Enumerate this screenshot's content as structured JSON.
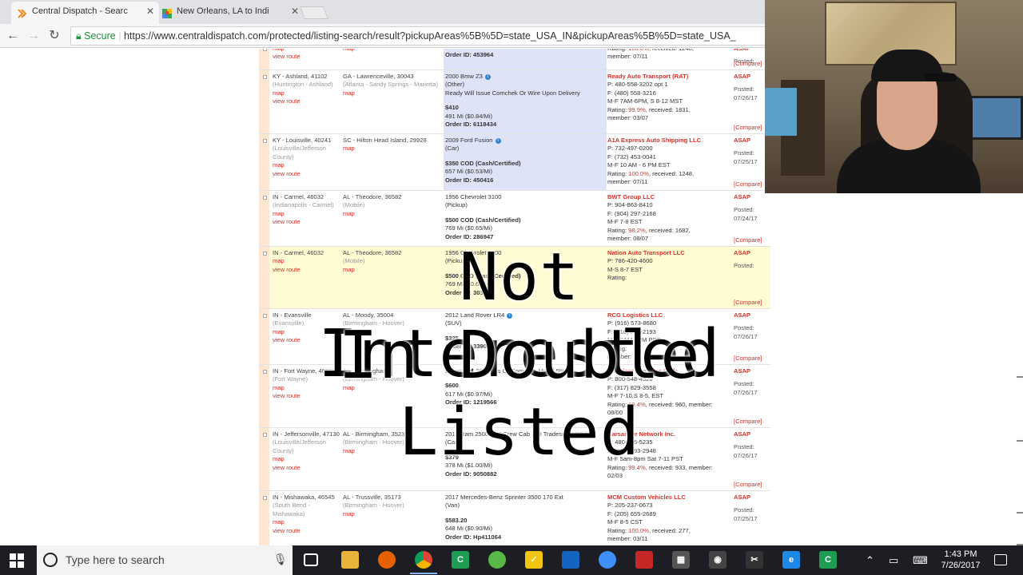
{
  "browser": {
    "tabs": [
      {
        "title": "Central Dispatch - Searc",
        "active": true
      },
      {
        "title": "New Orleans, LA to Indi",
        "active": false
      }
    ],
    "secure_label": "Secure",
    "url": "https://www.centraldispatch.com/protected/listing-search/result?pickupAreas%5B%5D=state_USA_IN&pickupAreas%5B%5D=state_USA_"
  },
  "overlay": {
    "line1": "Not Interested",
    "line2": "In Double Listed"
  },
  "links": {
    "map": "map",
    "view_route": "view route",
    "compare": "[Compare]",
    "asap": "ASAP",
    "posted": "Posted:"
  },
  "listings": [
    {
      "origin": "",
      "origin_sub": "",
      "dest": "",
      "dest_sub": "",
      "vehicle": "",
      "vehicle_type": "",
      "note": "",
      "pay": "999 Mi ($0.43/Mi)",
      "price": "",
      "rate": "",
      "order": "Order ID: 453964",
      "carrier": "",
      "phone": "",
      "phone2": "",
      "hours": "",
      "rating_pre": "Rating: ",
      "rating_pct": "100.0%",
      "rating_post": ", received: 1248,",
      "member": "member: 07/11",
      "posted_date": ""
    },
    {
      "origin": "KY - Ashland, 41102",
      "origin_sub": "(Huntington - Ashland)",
      "dest": "GA - Lawrenceville, 30043",
      "dest_sub": "(Atlanta - Sandy Springs - Marietta)",
      "vehicle": "2000 Bmw Z3",
      "vehicle_type": "(Other)",
      "note": "Ready Will Issue Comchek Or Wire Upon Delivery",
      "price": "$410",
      "rate": "491 Mi ($0.84/Mi)",
      "order": "Order ID: 6118434",
      "carrier": "Ready Auto Transport (RAT)",
      "phone": "P: 480-558-3202 opt 1",
      "phone2": "F: (480) 558-3216",
      "hours": "M-F 7AM-6PM, S 8-12 MST",
      "rating_pre": "Rating: ",
      "rating_pct": "99.9%",
      "rating_post": ", received: 1831,",
      "member": "member: 03/07",
      "posted_date": "07/26/17"
    },
    {
      "origin": "KY - Louisville, 40241",
      "origin_sub": "(Louisville/Jefferson County)",
      "dest": "SC - Hilton Head Island, 29928",
      "dest_sub": "",
      "vehicle": "2009 Ford Fusion",
      "vehicle_type": "(Car)",
      "note": "",
      "price": "$350 COD (Cash/Certified)",
      "rate": "657 Mi ($0.53/Mi)",
      "order": "Order ID: 450416",
      "carrier": "A1A Express Auto Shipping LLC",
      "phone": "P: 732-497-0200",
      "phone2": "F: (732) 453-0041",
      "hours": "M-F 10 AM - 6 PM EST",
      "rating_pre": "Rating: ",
      "rating_pct": "100.0%",
      "rating_post": ", received: 1248,",
      "member": "member: 07/11",
      "posted_date": "07/25/17"
    },
    {
      "origin": "IN - Carmel, 46032",
      "origin_sub": "(Indianapolis - Carmel)",
      "dest": "AL - Theodore, 36582",
      "dest_sub": "(Mobile)",
      "vehicle": "1956 Chevrolet 3100",
      "vehicle_type": "(Pickup)",
      "note": "",
      "price": "$500 COD (Cash/Certified)",
      "rate": "769 Mi ($0.65/Mi)",
      "order": "Order ID: 286947",
      "carrier": "BWT Group LLC",
      "phone": "P: 904-863-8410",
      "phone2": "F: (904) 297-2168",
      "hours": "M-F 7-8 EST",
      "rating_pre": "Rating: ",
      "rating_pct": "98.2%",
      "rating_post": ", received: 1682,",
      "member": "member: 08/07",
      "posted_date": "07/24/17"
    },
    {
      "origin": "IN - Carmel, 46032",
      "origin_sub": "",
      "dest": "AL - Theodore, 36582",
      "dest_sub": "(Mobile)",
      "vehicle": "1956 Chevrolet 3100",
      "vehicle_type": "(Pickup)",
      "note": "",
      "price": "$500 COD (Cash/Certified)",
      "rate": "769 Mi ($0.65/Mi)",
      "order": "Order ID: 303838",
      "carrier": "Nation Auto Transport LLC",
      "phone": "P: 786-420-4600",
      "phone2": "",
      "hours": "M-S 8-7 EST",
      "rating_pre": "Rating: ",
      "rating_pct": "",
      "rating_post": "",
      "member": "",
      "posted_date": ""
    },
    {
      "origin": "IN - Evansville",
      "origin_sub": "(Evansville)",
      "dest": "AL - Moody, 35004",
      "dest_sub": "(Birmingham - Hoover)",
      "vehicle": "2012 Land Rover LR4",
      "vehicle_type": "(SUV)",
      "note": "",
      "price": "$325",
      "rate": "",
      "order": "Order ID: 3390",
      "carrier": "RCG Logistics LLC",
      "phone": "P: (916) 573-8680",
      "phone2": "F: (916) 852-2193",
      "hours": "M-F 8AM-4PM PST",
      "rating_pre": "Rating: ",
      "rating_pct": "",
      "rating_post": "",
      "member": "member: 1",
      "posted_date": "07/26/17"
    },
    {
      "origin": "IN - Fort Wayne, 46808",
      "origin_sub": "(Fort Wayne)",
      "dest": "AL - Birmingham",
      "dest_sub": "(Birmingham - Hoover)",
      "vehicle": "",
      "vehicle_type": "",
      "note": "Billing: Net 20 Terms Or Comchek Minus 5%Fee",
      "price": "$600",
      "rate": "617 Mi ($0.97/Mi)",
      "order": "Order ID: 1219566",
      "carrier": "Reindeer Logistics Corp",
      "phone": "P: 800-548-4520",
      "phone2": "F: (317) 829-3558",
      "hours": "M-F 7-10,S 8-5, EST",
      "rating_pre": "Rating: ",
      "rating_pct": "99.4%",
      "rating_post": ", received: 960, member:",
      "member": "08/00",
      "posted_date": "07/26/17"
    },
    {
      "origin": "IN - Jeffersonville, 47130",
      "origin_sub": "(Louisville/Jefferson County)",
      "dest": "AL - Birmingham, 35233",
      "dest_sub": "(Birmingham - Hoover)",
      "vehicle": "2013 Ram 2500 4wd Crew Cab 169 Tradesman White",
      "vehicle_type": "(Car)",
      "note": "",
      "price": "$379",
      "rate": "378 Mi ($1.00/Mi)",
      "order": "Order ID: 9050882",
      "carrier": "Carsarrive Network Inc.",
      "phone": "P: 480-556-5235",
      "phone2": "F: (480) 393-2948",
      "hours": "M-F 5am-8pm Sat 7-11 PST",
      "rating_pre": "Rating: ",
      "rating_pct": "99.4%",
      "rating_post": ", received: 933, member:",
      "member": "02/03",
      "posted_date": "07/26/17"
    },
    {
      "origin": "IN - Mishawaka, 46545",
      "origin_sub": "(South Bend - Mishawaka)",
      "dest": "AL - Trussville, 35173",
      "dest_sub": "(Birmingham - Hoover)",
      "vehicle": "2017 Mercedes-Benz Sprinter 3500 170 Ext",
      "vehicle_type": "(Van)",
      "note": "",
      "price": "$583.20",
      "rate": "648 Mi ($0.90/Mi)",
      "order": "Order ID: Hp411064",
      "carrier": "MCM Custom Vehicles LLC",
      "phone": "P: 205-237-0673",
      "phone2": "F: (205) 655-2689",
      "hours": "M-F 8-5 CST",
      "rating_pre": "Rating: ",
      "rating_pct": "100.0%",
      "rating_post": ", received: 277,",
      "member": "member: 03/11",
      "posted_date": "07/25/17"
    }
  ],
  "taskbar": {
    "search_placeholder": "Type here to search",
    "time": "1:43 PM",
    "date": "7/26/2017"
  }
}
